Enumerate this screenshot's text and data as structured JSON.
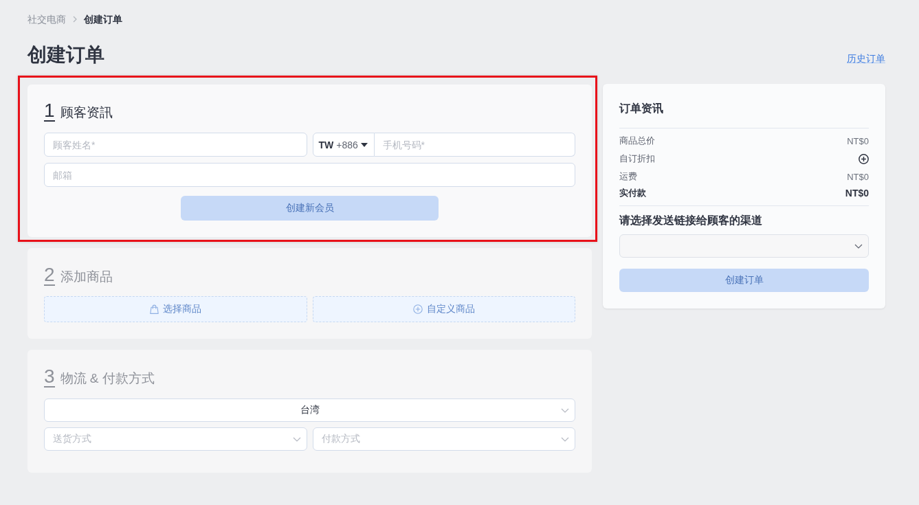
{
  "breadcrumb": [
    {
      "label": "社交电商",
      "current": false
    },
    {
      "label": "创建订单",
      "current": true
    }
  ],
  "page_title": "创建订单",
  "history_link": "历史订单",
  "sections": [
    {
      "kind": "customer",
      "number": "1",
      "title": "顾客资訊",
      "disabled": false,
      "highlighted": true,
      "name_field": {
        "placeholder": "顾客姓名*"
      },
      "phone": {
        "country": "TW",
        "dial_code": "+886",
        "placeholder": "手机号码*"
      },
      "email_field": {
        "placeholder": "邮箱"
      },
      "button": {
        "label": "创建新会员",
        "disabled": true
      }
    },
    {
      "kind": "products",
      "number": "2",
      "title": "添加商品",
      "disabled": true,
      "highlighted": false,
      "buttons": [
        {
          "label": "选择商品",
          "disabled": true
        },
        {
          "label": "自定义商品",
          "disabled": true
        }
      ]
    },
    {
      "kind": "logistics",
      "number": "3",
      "title": "物流 & 付款方式",
      "disabled": true,
      "highlighted": false,
      "region_select": {
        "value": "台湾"
      },
      "shipping_select": {
        "placeholder": "送货方式"
      },
      "payment_select": {
        "placeholder": "付款方式"
      }
    }
  ],
  "order_summary": {
    "title": "订单资讯",
    "rows": [
      {
        "kind": "amount",
        "label": "商品总价",
        "value": "NT$0"
      },
      {
        "kind": "action",
        "label": "自订折扣"
      },
      {
        "kind": "amount",
        "label": "运费",
        "value": "NT$0"
      },
      {
        "kind": "total",
        "label": "实付款",
        "value": "NT$0"
      }
    ],
    "channel_prompt": "请选择发送链接给顾客的渠道",
    "button": {
      "label": "创建订单",
      "disabled": true
    }
  }
}
